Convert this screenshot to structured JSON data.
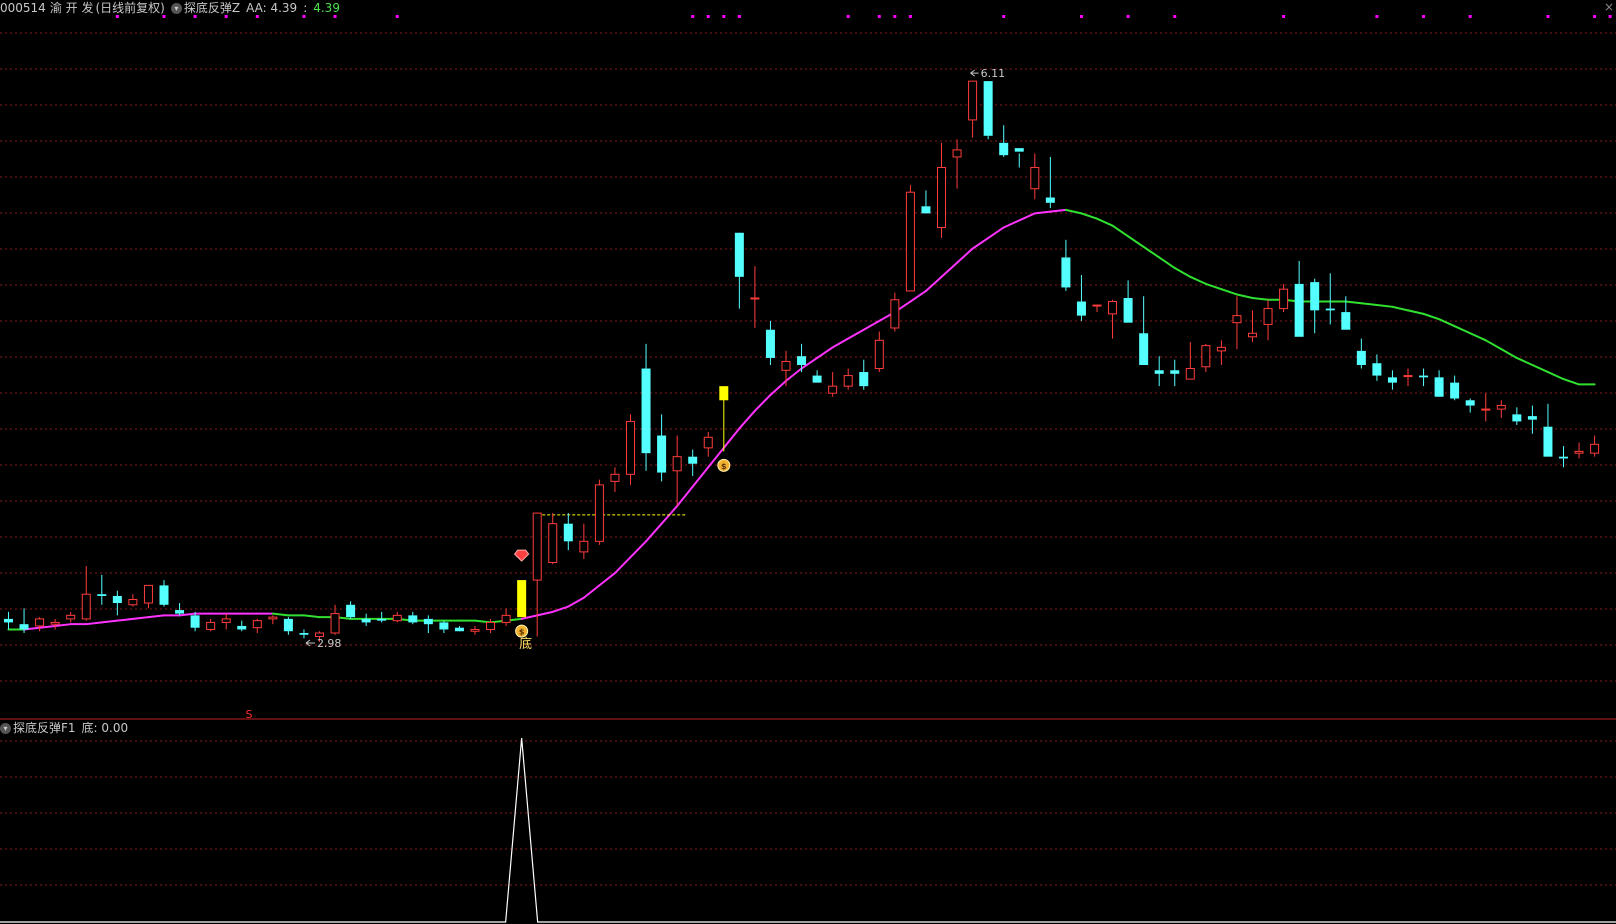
{
  "main": {
    "stock_code": "000514",
    "stock_name": "渝 开 发",
    "adjust_label": "(日线前复权)",
    "indicator_name": "探底反弹Z",
    "aa_label": "AA: 4.39",
    "aa_sep": ":",
    "aa_value2": "4.39",
    "close_glyph": "×"
  },
  "sub": {
    "indicator_name": "探底反弹F1",
    "value_label": "底: 0.00"
  },
  "annotations": {
    "low_price": "2.98",
    "high_price": "6.11",
    "bottom_label": "底",
    "s_mark": "S"
  },
  "colors": {
    "up": "#ff3c3c",
    "down": "#54ffff",
    "signal": "#ffff00",
    "ma_up": "#ff32ff",
    "ma_down": "#30e030",
    "grid": "#8a1a1a",
    "background": "#000000",
    "magenta_dot": "#ff00ff"
  },
  "chart_data": [
    {
      "type": "candlestick",
      "title": "",
      "ylim": [
        2.6,
        6.4
      ],
      "grid": true,
      "ohlc": [
        [
          3.06,
          3.1,
          3.0,
          3.04
        ],
        [
          3.03,
          3.12,
          2.98,
          3.0
        ],
        [
          3.02,
          3.07,
          2.99,
          3.06
        ],
        [
          3.03,
          3.06,
          3.0,
          3.04
        ],
        [
          3.06,
          3.1,
          3.04,
          3.08
        ],
        [
          3.06,
          3.36,
          3.05,
          3.2
        ],
        [
          3.2,
          3.31,
          3.14,
          3.19
        ],
        [
          3.19,
          3.22,
          3.08,
          3.15
        ],
        [
          3.14,
          3.2,
          3.13,
          3.17
        ],
        [
          3.15,
          3.24,
          3.12,
          3.25
        ],
        [
          3.25,
          3.28,
          3.13,
          3.14
        ],
        [
          3.11,
          3.15,
          3.08,
          3.09
        ],
        [
          3.08,
          3.1,
          2.99,
          3.01
        ],
        [
          3.0,
          3.06,
          2.99,
          3.04
        ],
        [
          3.04,
          3.09,
          3.0,
          3.06
        ],
        [
          3.02,
          3.05,
          2.99,
          3.0
        ],
        [
          3.01,
          3.06,
          2.98,
          3.05
        ],
        [
          3.06,
          3.08,
          3.03,
          3.07
        ],
        [
          3.06,
          3.07,
          2.97,
          2.99
        ],
        [
          2.98,
          3.0,
          2.95,
          2.97
        ],
        [
          2.96,
          2.99,
          2.93,
          2.98
        ],
        [
          2.98,
          3.14,
          2.97,
          3.09
        ],
        [
          3.14,
          3.16,
          3.06,
          3.07
        ],
        [
          3.06,
          3.09,
          3.02,
          3.04
        ],
        [
          3.06,
          3.1,
          3.04,
          3.05
        ],
        [
          3.05,
          3.1,
          3.04,
          3.08
        ],
        [
          3.08,
          3.1,
          3.03,
          3.04
        ],
        [
          3.06,
          3.08,
          2.98,
          3.03
        ],
        [
          3.04,
          3.05,
          2.98,
          3.0
        ],
        [
          3.01,
          3.02,
          2.99,
          2.99
        ],
        [
          2.99,
          3.02,
          2.97,
          3.0
        ],
        [
          3.0,
          3.06,
          2.98,
          3.04
        ],
        [
          3.04,
          3.12,
          3.02,
          3.08
        ],
        [
          3.07,
          3.28,
          3.07,
          3.28
        ],
        [
          3.28,
          3.3,
          2.96,
          3.66
        ],
        [
          3.38,
          3.66,
          3.37,
          3.6
        ],
        [
          3.6,
          3.66,
          3.45,
          3.5
        ],
        [
          3.44,
          3.6,
          3.4,
          3.5
        ],
        [
          3.5,
          3.85,
          3.48,
          3.82
        ],
        [
          3.84,
          3.92,
          3.78,
          3.88
        ],
        [
          3.88,
          4.22,
          3.82,
          4.18
        ],
        [
          4.48,
          4.62,
          3.9,
          4.0
        ],
        [
          4.1,
          4.22,
          3.84,
          3.89
        ],
        [
          3.9,
          4.1,
          3.7,
          3.98
        ],
        [
          3.98,
          4.02,
          3.87,
          3.94
        ],
        [
          4.03,
          4.12,
          3.98,
          4.09
        ],
        [
          4.3,
          4.34,
          4.01,
          4.38
        ],
        [
          5.25,
          5.25,
          4.82,
          5.0
        ],
        [
          4.88,
          5.06,
          4.71,
          4.88
        ],
        [
          4.7,
          4.75,
          4.5,
          4.54
        ],
        [
          4.47,
          4.58,
          4.38,
          4.52
        ],
        [
          4.55,
          4.62,
          4.46,
          4.5
        ],
        [
          4.44,
          4.47,
          4.4,
          4.4
        ],
        [
          4.34,
          4.46,
          4.32,
          4.38
        ],
        [
          4.38,
          4.48,
          4.36,
          4.44
        ],
        [
          4.46,
          4.53,
          4.36,
          4.38
        ],
        [
          4.48,
          4.69,
          4.46,
          4.64
        ],
        [
          4.71,
          4.91,
          4.69,
          4.87
        ],
        [
          4.92,
          5.52,
          4.92,
          5.48
        ],
        [
          5.4,
          5.49,
          5.4,
          5.36
        ],
        [
          5.28,
          5.76,
          5.22,
          5.62
        ],
        [
          5.68,
          5.78,
          5.5,
          5.72
        ],
        [
          5.89,
          6.04,
          5.79,
          6.11
        ],
        [
          6.11,
          6.11,
          5.78,
          5.8
        ],
        [
          5.76,
          5.86,
          5.68,
          5.69
        ],
        [
          5.73,
          5.7,
          5.62,
          5.71
        ],
        [
          5.5,
          5.7,
          5.44,
          5.62
        ],
        [
          5.45,
          5.68,
          5.39,
          5.42
        ],
        [
          5.11,
          5.21,
          4.92,
          4.94
        ],
        [
          4.86,
          5.01,
          4.75,
          4.78
        ],
        [
          4.84,
          4.84,
          4.8,
          4.84
        ],
        [
          4.79,
          4.87,
          4.65,
          4.86
        ],
        [
          4.88,
          4.98,
          4.77,
          4.74
        ],
        [
          4.68,
          4.89,
          4.53,
          4.5
        ],
        [
          4.47,
          4.55,
          4.38,
          4.45
        ],
        [
          4.47,
          4.53,
          4.38,
          4.45
        ],
        [
          4.42,
          4.63,
          4.42,
          4.48
        ],
        [
          4.49,
          4.62,
          4.46,
          4.61
        ],
        [
          4.58,
          4.64,
          4.5,
          4.6
        ],
        [
          4.74,
          4.89,
          4.59,
          4.78
        ],
        [
          4.66,
          4.81,
          4.63,
          4.68
        ],
        [
          4.73,
          4.87,
          4.64,
          4.82
        ],
        [
          4.82,
          4.96,
          4.8,
          4.93
        ],
        [
          4.96,
          5.09,
          4.87,
          4.66
        ],
        [
          4.97,
          4.99,
          4.68,
          4.81
        ],
        [
          4.82,
          5.02,
          4.73,
          4.81
        ],
        [
          4.8,
          4.89,
          4.77,
          4.7
        ],
        [
          4.58,
          4.65,
          4.48,
          4.5
        ],
        [
          4.51,
          4.56,
          4.41,
          4.44
        ],
        [
          4.43,
          4.47,
          4.36,
          4.4
        ],
        [
          4.44,
          4.48,
          4.38,
          4.44
        ],
        [
          4.44,
          4.48,
          4.38,
          4.43
        ],
        [
          4.43,
          4.47,
          4.32,
          4.32
        ],
        [
          4.4,
          4.44,
          4.3,
          4.31
        ],
        [
          4.3,
          4.31,
          4.23,
          4.27
        ],
        [
          4.25,
          4.34,
          4.18,
          4.25
        ],
        [
          4.25,
          4.3,
          4.2,
          4.27
        ],
        [
          4.22,
          4.26,
          4.16,
          4.18
        ],
        [
          4.21,
          4.27,
          4.11,
          4.19
        ],
        [
          4.15,
          4.28,
          4.09,
          3.98
        ],
        [
          3.98,
          4.04,
          3.92,
          3.97
        ],
        [
          4.0,
          4.06,
          3.97,
          4.01
        ],
        [
          4.0,
          4.1,
          3.98,
          4.05
        ]
      ],
      "ma_line": [
        3.0,
        3.0,
        3.01,
        3.02,
        3.03,
        3.03,
        3.04,
        3.05,
        3.06,
        3.07,
        3.08,
        3.08,
        3.09,
        3.09,
        3.09,
        3.09,
        3.09,
        3.09,
        3.08,
        3.08,
        3.07,
        3.07,
        3.06,
        3.06,
        3.06,
        3.06,
        3.05,
        3.05,
        3.05,
        3.05,
        3.05,
        3.04,
        3.05,
        3.06,
        3.08,
        3.1,
        3.13,
        3.18,
        3.25,
        3.32,
        3.41,
        3.5,
        3.6,
        3.7,
        3.81,
        3.92,
        4.03,
        4.14,
        4.24,
        4.33,
        4.41,
        4.48,
        4.54,
        4.6,
        4.65,
        4.7,
        4.75,
        4.8,
        4.86,
        4.92,
        5.0,
        5.08,
        5.16,
        5.22,
        5.28,
        5.32,
        5.36,
        5.37,
        5.38,
        5.36,
        5.33,
        5.29,
        5.23,
        5.17,
        5.11,
        5.05,
        5.0,
        4.96,
        4.93,
        4.9,
        4.88,
        4.87,
        4.87,
        4.86,
        4.86,
        4.86,
        4.86,
        4.85,
        4.84,
        4.83,
        4.81,
        4.79,
        4.76,
        4.72,
        4.68,
        4.64,
        4.59,
        4.54,
        4.5,
        4.46,
        4.42,
        4.39,
        4.39
      ],
      "ma_green_ranges": [
        [
          0,
          1
        ],
        [
          17,
          33
        ],
        [
          68,
          103
        ]
      ],
      "signals": [
        {
          "index": 33,
          "type": "buy-diamond",
          "label": "底"
        },
        {
          "index": 33,
          "type": "money-bag"
        },
        {
          "index": 46,
          "type": "money-bag"
        }
      ],
      "dashed_level": {
        "start_index": 34,
        "end_index": 41,
        "value": 3.65
      },
      "low_marker": {
        "index": 19,
        "value": 2.98
      },
      "high_marker": {
        "index": 62,
        "value": 6.11
      },
      "magenta_dot_indices": [
        7,
        10,
        12,
        14,
        16,
        19,
        21,
        25,
        44,
        45,
        46,
        47,
        54,
        56,
        57,
        58,
        64,
        69,
        72,
        75,
        82,
        88,
        91,
        94,
        99,
        102,
        103
      ]
    },
    {
      "type": "line",
      "title": "",
      "ylim": [
        0,
        1
      ],
      "series": [
        {
          "values_spike_index": 33,
          "values_spike": 1
        }
      ]
    }
  ]
}
